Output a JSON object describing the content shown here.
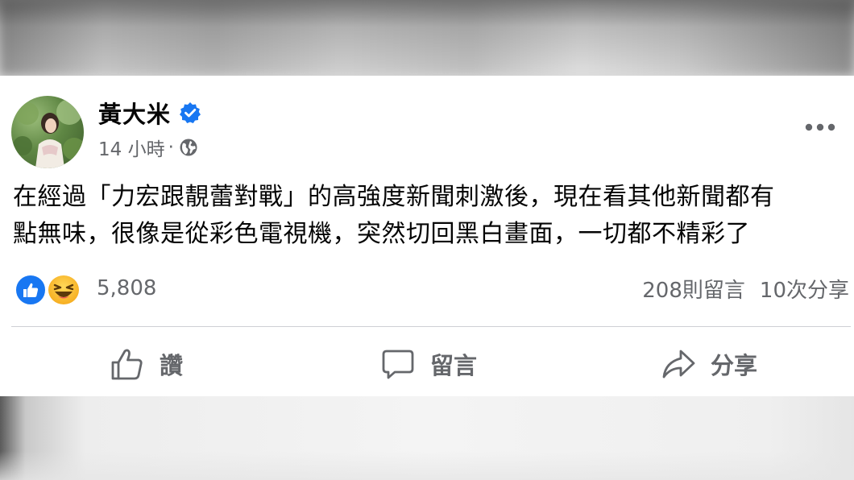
{
  "post": {
    "author": "黃大米",
    "verified": true,
    "time": "14 小時",
    "separator": "·",
    "audience_icon": "globe-icon",
    "more_icon": "more-options-icon",
    "text_lines": [
      "在經過「力宏跟靚蕾對戰」的高強度新聞刺激後，現在看其他新聞都有",
      "點無味，很像是從彩色電視機，突然切回黑白畫面，一切都不精彩了"
    ],
    "reactions": {
      "types": [
        "like",
        "haha"
      ],
      "count": "5,808"
    },
    "comments_count": "208則留言",
    "shares_count": "10次分享",
    "actions": {
      "like_label": "讚",
      "comment_label": "留言",
      "share_label": "分享"
    }
  },
  "colors": {
    "verified_blue": "#1877f2",
    "secondary_text": "#65676b",
    "primary_text": "#050505",
    "divider": "#ced0d4"
  }
}
